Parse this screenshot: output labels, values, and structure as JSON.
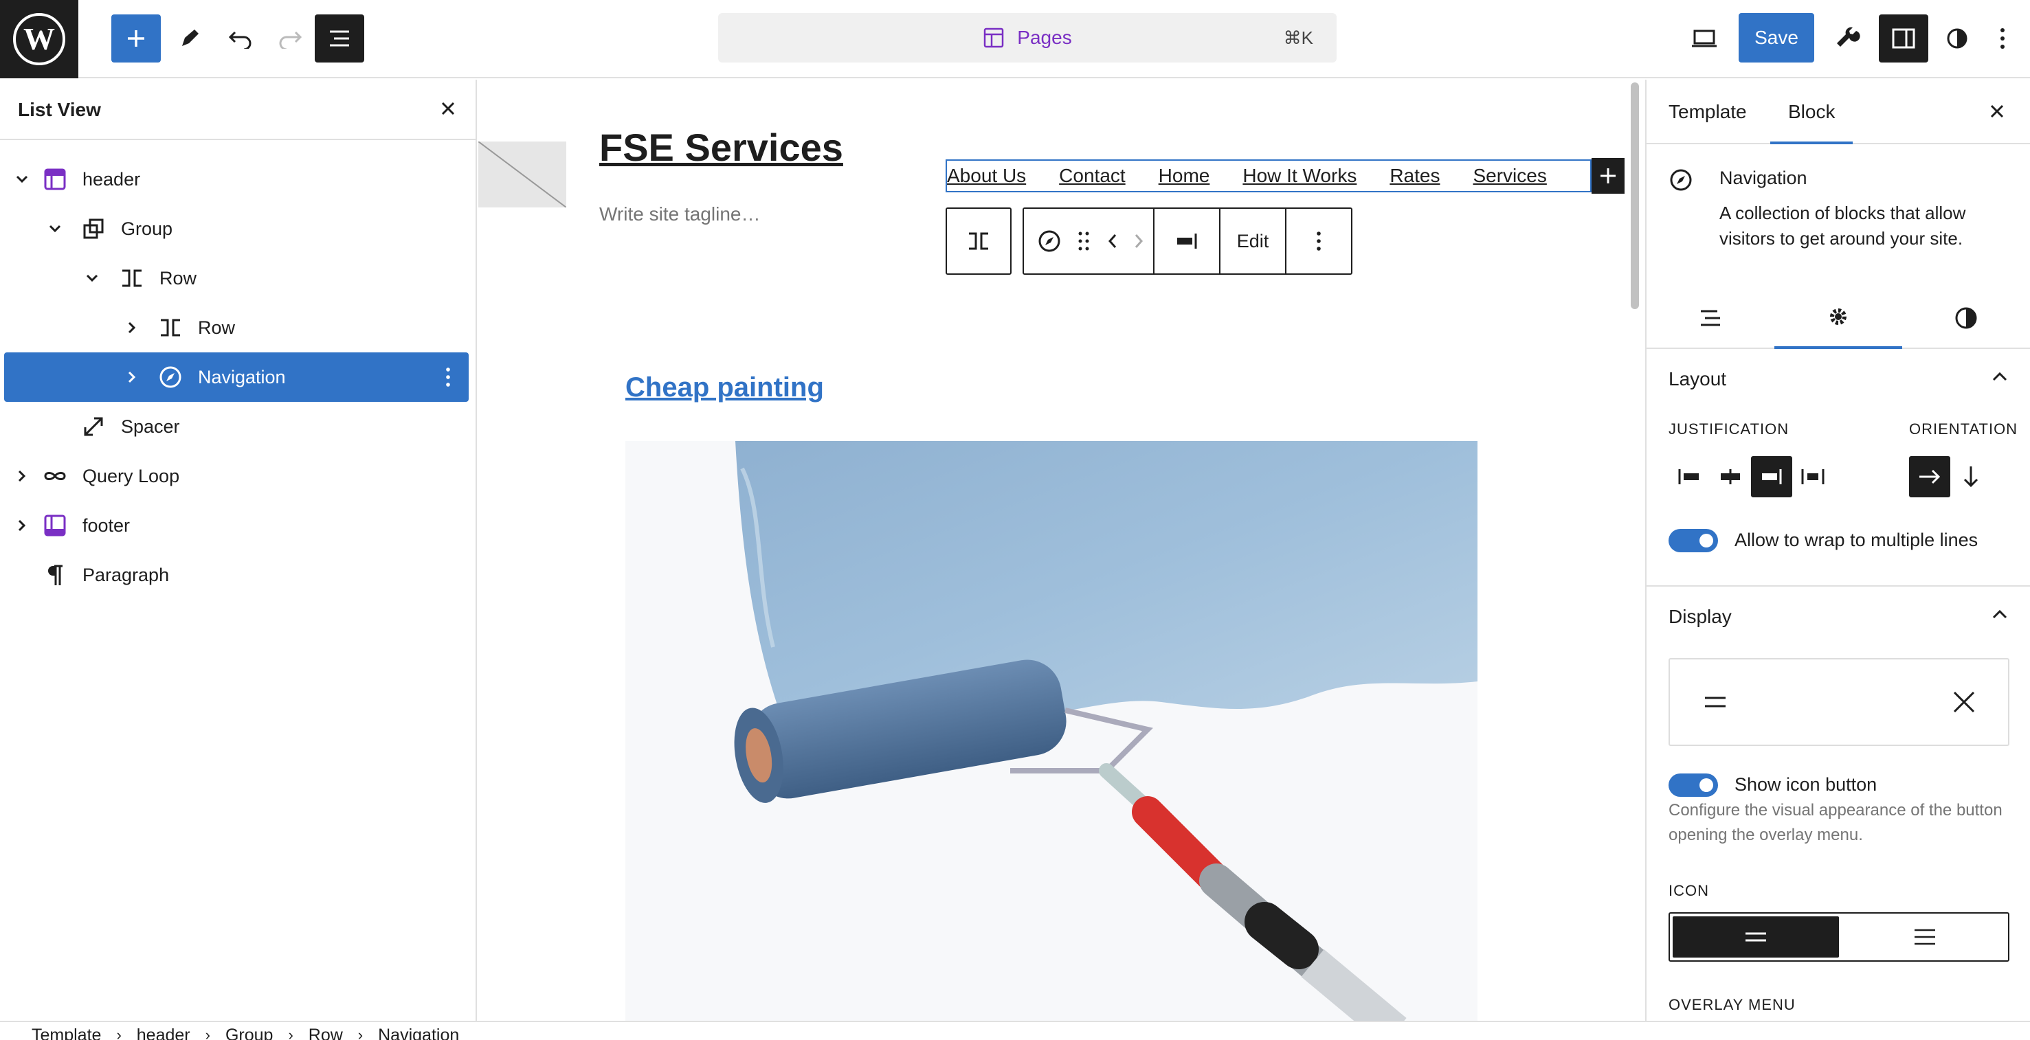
{
  "topbar": {
    "command_label": "Pages",
    "command_shortcut": "⌘K",
    "save_label": "Save"
  },
  "listview": {
    "title": "List View",
    "items": [
      {
        "label": "header",
        "icon": "template-part-icon"
      },
      {
        "label": "Group",
        "icon": "group-icon"
      },
      {
        "label": "Row",
        "icon": "row-icon"
      },
      {
        "label": "Row",
        "icon": "row-icon"
      },
      {
        "label": "Navigation",
        "icon": "navigation-icon"
      },
      {
        "label": "Spacer",
        "icon": "spacer-icon"
      },
      {
        "label": "Query Loop",
        "icon": "loop-icon"
      },
      {
        "label": "footer",
        "icon": "template-part-icon"
      },
      {
        "label": "Paragraph",
        "icon": "paragraph-icon"
      }
    ]
  },
  "canvas": {
    "site_title": "FSE Services",
    "tagline_placeholder": "Write site tagline…",
    "nav_links": [
      "About Us",
      "Contact",
      "Home",
      "How It Works",
      "Rates",
      "Services"
    ],
    "toolbar_edit_label": "Edit",
    "post_title": "Cheap painting"
  },
  "settings": {
    "tabs": [
      "Template",
      "Block"
    ],
    "block_name": "Navigation",
    "block_description": "A collection of blocks that allow visitors to get around your site.",
    "layout": {
      "heading": "Layout",
      "justification_label": "JUSTIFICATION",
      "orientation_label": "ORIENTATION",
      "wrap_label": "Allow to wrap to multiple lines"
    },
    "display": {
      "heading": "Display",
      "show_icon_label": "Show icon button",
      "help_text": "Configure the visual appearance of the button opening the overlay menu.",
      "icon_label": "ICON",
      "overlay_label": "OVERLAY MENU"
    }
  },
  "breadcrumbs": [
    "Template",
    "header",
    "Group",
    "Row",
    "Navigation"
  ],
  "colors": {
    "accent": "#3173c6",
    "brand_purple": "#7a2fc4",
    "dark": "#1e1e1e"
  }
}
